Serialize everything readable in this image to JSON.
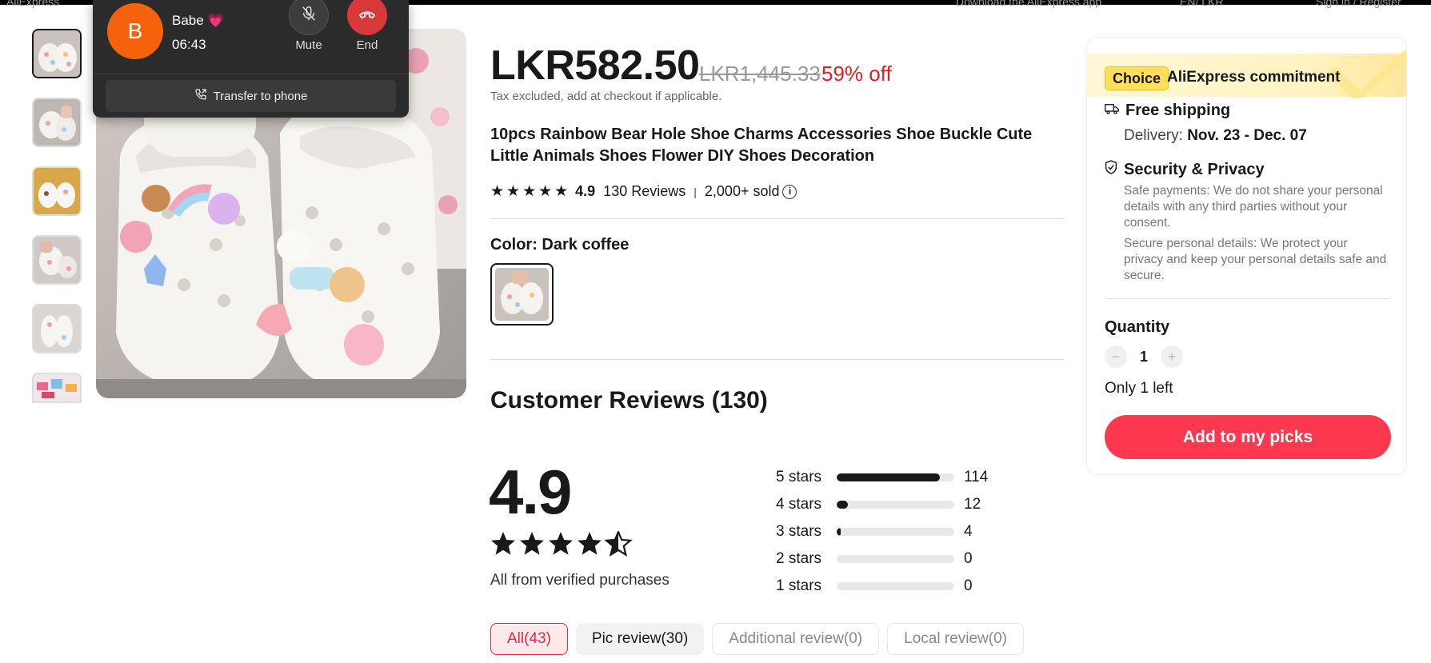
{
  "header": {
    "logo_text": "AliExpress",
    "download_text": "Download the AliExpress app",
    "locale_text": "EN/ LKR",
    "signin_text": "Sign in / Register"
  },
  "call": {
    "avatar_letter": "B",
    "name": "Babe 💗",
    "duration": "06:43",
    "mute_label": "Mute",
    "end_label": "End",
    "transfer_label": "Transfer to phone"
  },
  "product": {
    "price": "LKR582.50",
    "original_price": "LKR1,445.33",
    "discount": "59% off",
    "tax_note": "Tax excluded, add at checkout if applicable.",
    "title": "10pcs Rainbow Bear Hole Shoe Charms Accessories Shoe Buckle Cute Little Animals Shoes Flower DIY Shoes Decoration",
    "rating": "4.9",
    "reviews_count_text": "130 Reviews",
    "sold_text": "2,000+ sold",
    "color_label": "Color: Dark coffee"
  },
  "reviews": {
    "title": "Customer Reviews (130)",
    "score": "4.9",
    "score_value": 4.9,
    "verified_text": "All from verified purchases",
    "breakdown": [
      {
        "label": "5 stars",
        "count": "114",
        "fraction": 0.877
      },
      {
        "label": "4 stars",
        "count": "12",
        "fraction": 0.092
      },
      {
        "label": "3 stars",
        "count": "4",
        "fraction": 0.031
      },
      {
        "label": "2 stars",
        "count": "0",
        "fraction": 0
      },
      {
        "label": "1 stars",
        "count": "0",
        "fraction": 0
      }
    ],
    "filters": [
      "All(43)",
      "Pic review(30)",
      "Additional review(0)",
      "Local review(0)"
    ]
  },
  "card": {
    "choice_badge": "Choice",
    "choice_text": "AliExpress commitment",
    "shipping_title": "Free shipping",
    "delivery_label": "Delivery: ",
    "delivery_dates": "Nov. 23 - Dec. 07",
    "security_title": "Security & Privacy",
    "security_text_1": "Safe payments: We do not share your personal details with any third parties without your consent.",
    "security_text_2": "Secure personal details: We protect your privacy and keep your personal details safe and secure.",
    "quantity_label": "Quantity",
    "quantity_value": "1",
    "stock_text": "Only 1 left",
    "add_button": "Add to my picks"
  },
  "colors": {
    "accent_red": "#e02020",
    "button_red": "#fd384f",
    "call_orange": "#f4620c",
    "choice_yellow": "#ffde59"
  }
}
